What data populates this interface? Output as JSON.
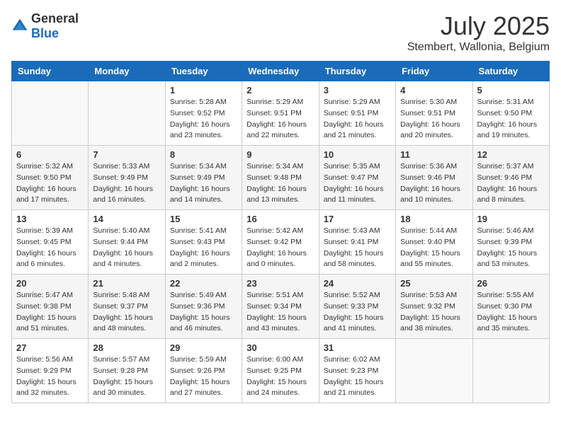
{
  "header": {
    "logo_general": "General",
    "logo_blue": "Blue",
    "month_year": "July 2025",
    "location": "Stembert, Wallonia, Belgium"
  },
  "weekdays": [
    "Sunday",
    "Monday",
    "Tuesday",
    "Wednesday",
    "Thursday",
    "Friday",
    "Saturday"
  ],
  "weeks": [
    [
      {
        "day": "",
        "info": ""
      },
      {
        "day": "",
        "info": ""
      },
      {
        "day": "1",
        "info": "Sunrise: 5:28 AM\nSunset: 9:52 PM\nDaylight: 16 hours\nand 23 minutes."
      },
      {
        "day": "2",
        "info": "Sunrise: 5:29 AM\nSunset: 9:51 PM\nDaylight: 16 hours\nand 22 minutes."
      },
      {
        "day": "3",
        "info": "Sunrise: 5:29 AM\nSunset: 9:51 PM\nDaylight: 16 hours\nand 21 minutes."
      },
      {
        "day": "4",
        "info": "Sunrise: 5:30 AM\nSunset: 9:51 PM\nDaylight: 16 hours\nand 20 minutes."
      },
      {
        "day": "5",
        "info": "Sunrise: 5:31 AM\nSunset: 9:50 PM\nDaylight: 16 hours\nand 19 minutes."
      }
    ],
    [
      {
        "day": "6",
        "info": "Sunrise: 5:32 AM\nSunset: 9:50 PM\nDaylight: 16 hours\nand 17 minutes."
      },
      {
        "day": "7",
        "info": "Sunrise: 5:33 AM\nSunset: 9:49 PM\nDaylight: 16 hours\nand 16 minutes."
      },
      {
        "day": "8",
        "info": "Sunrise: 5:34 AM\nSunset: 9:49 PM\nDaylight: 16 hours\nand 14 minutes."
      },
      {
        "day": "9",
        "info": "Sunrise: 5:34 AM\nSunset: 9:48 PM\nDaylight: 16 hours\nand 13 minutes."
      },
      {
        "day": "10",
        "info": "Sunrise: 5:35 AM\nSunset: 9:47 PM\nDaylight: 16 hours\nand 11 minutes."
      },
      {
        "day": "11",
        "info": "Sunrise: 5:36 AM\nSunset: 9:46 PM\nDaylight: 16 hours\nand 10 minutes."
      },
      {
        "day": "12",
        "info": "Sunrise: 5:37 AM\nSunset: 9:46 PM\nDaylight: 16 hours\nand 8 minutes."
      }
    ],
    [
      {
        "day": "13",
        "info": "Sunrise: 5:39 AM\nSunset: 9:45 PM\nDaylight: 16 hours\nand 6 minutes."
      },
      {
        "day": "14",
        "info": "Sunrise: 5:40 AM\nSunset: 9:44 PM\nDaylight: 16 hours\nand 4 minutes."
      },
      {
        "day": "15",
        "info": "Sunrise: 5:41 AM\nSunset: 9:43 PM\nDaylight: 16 hours\nand 2 minutes."
      },
      {
        "day": "16",
        "info": "Sunrise: 5:42 AM\nSunset: 9:42 PM\nDaylight: 16 hours\nand 0 minutes."
      },
      {
        "day": "17",
        "info": "Sunrise: 5:43 AM\nSunset: 9:41 PM\nDaylight: 15 hours\nand 58 minutes."
      },
      {
        "day": "18",
        "info": "Sunrise: 5:44 AM\nSunset: 9:40 PM\nDaylight: 15 hours\nand 55 minutes."
      },
      {
        "day": "19",
        "info": "Sunrise: 5:46 AM\nSunset: 9:39 PM\nDaylight: 15 hours\nand 53 minutes."
      }
    ],
    [
      {
        "day": "20",
        "info": "Sunrise: 5:47 AM\nSunset: 9:38 PM\nDaylight: 15 hours\nand 51 minutes."
      },
      {
        "day": "21",
        "info": "Sunrise: 5:48 AM\nSunset: 9:37 PM\nDaylight: 15 hours\nand 48 minutes."
      },
      {
        "day": "22",
        "info": "Sunrise: 5:49 AM\nSunset: 9:36 PM\nDaylight: 15 hours\nand 46 minutes."
      },
      {
        "day": "23",
        "info": "Sunrise: 5:51 AM\nSunset: 9:34 PM\nDaylight: 15 hours\nand 43 minutes."
      },
      {
        "day": "24",
        "info": "Sunrise: 5:52 AM\nSunset: 9:33 PM\nDaylight: 15 hours\nand 41 minutes."
      },
      {
        "day": "25",
        "info": "Sunrise: 5:53 AM\nSunset: 9:32 PM\nDaylight: 15 hours\nand 38 minutes."
      },
      {
        "day": "26",
        "info": "Sunrise: 5:55 AM\nSunset: 9:30 PM\nDaylight: 15 hours\nand 35 minutes."
      }
    ],
    [
      {
        "day": "27",
        "info": "Sunrise: 5:56 AM\nSunset: 9:29 PM\nDaylight: 15 hours\nand 32 minutes."
      },
      {
        "day": "28",
        "info": "Sunrise: 5:57 AM\nSunset: 9:28 PM\nDaylight: 15 hours\nand 30 minutes."
      },
      {
        "day": "29",
        "info": "Sunrise: 5:59 AM\nSunset: 9:26 PM\nDaylight: 15 hours\nand 27 minutes."
      },
      {
        "day": "30",
        "info": "Sunrise: 6:00 AM\nSunset: 9:25 PM\nDaylight: 15 hours\nand 24 minutes."
      },
      {
        "day": "31",
        "info": "Sunrise: 6:02 AM\nSunset: 9:23 PM\nDaylight: 15 hours\nand 21 minutes."
      },
      {
        "day": "",
        "info": ""
      },
      {
        "day": "",
        "info": ""
      }
    ]
  ]
}
